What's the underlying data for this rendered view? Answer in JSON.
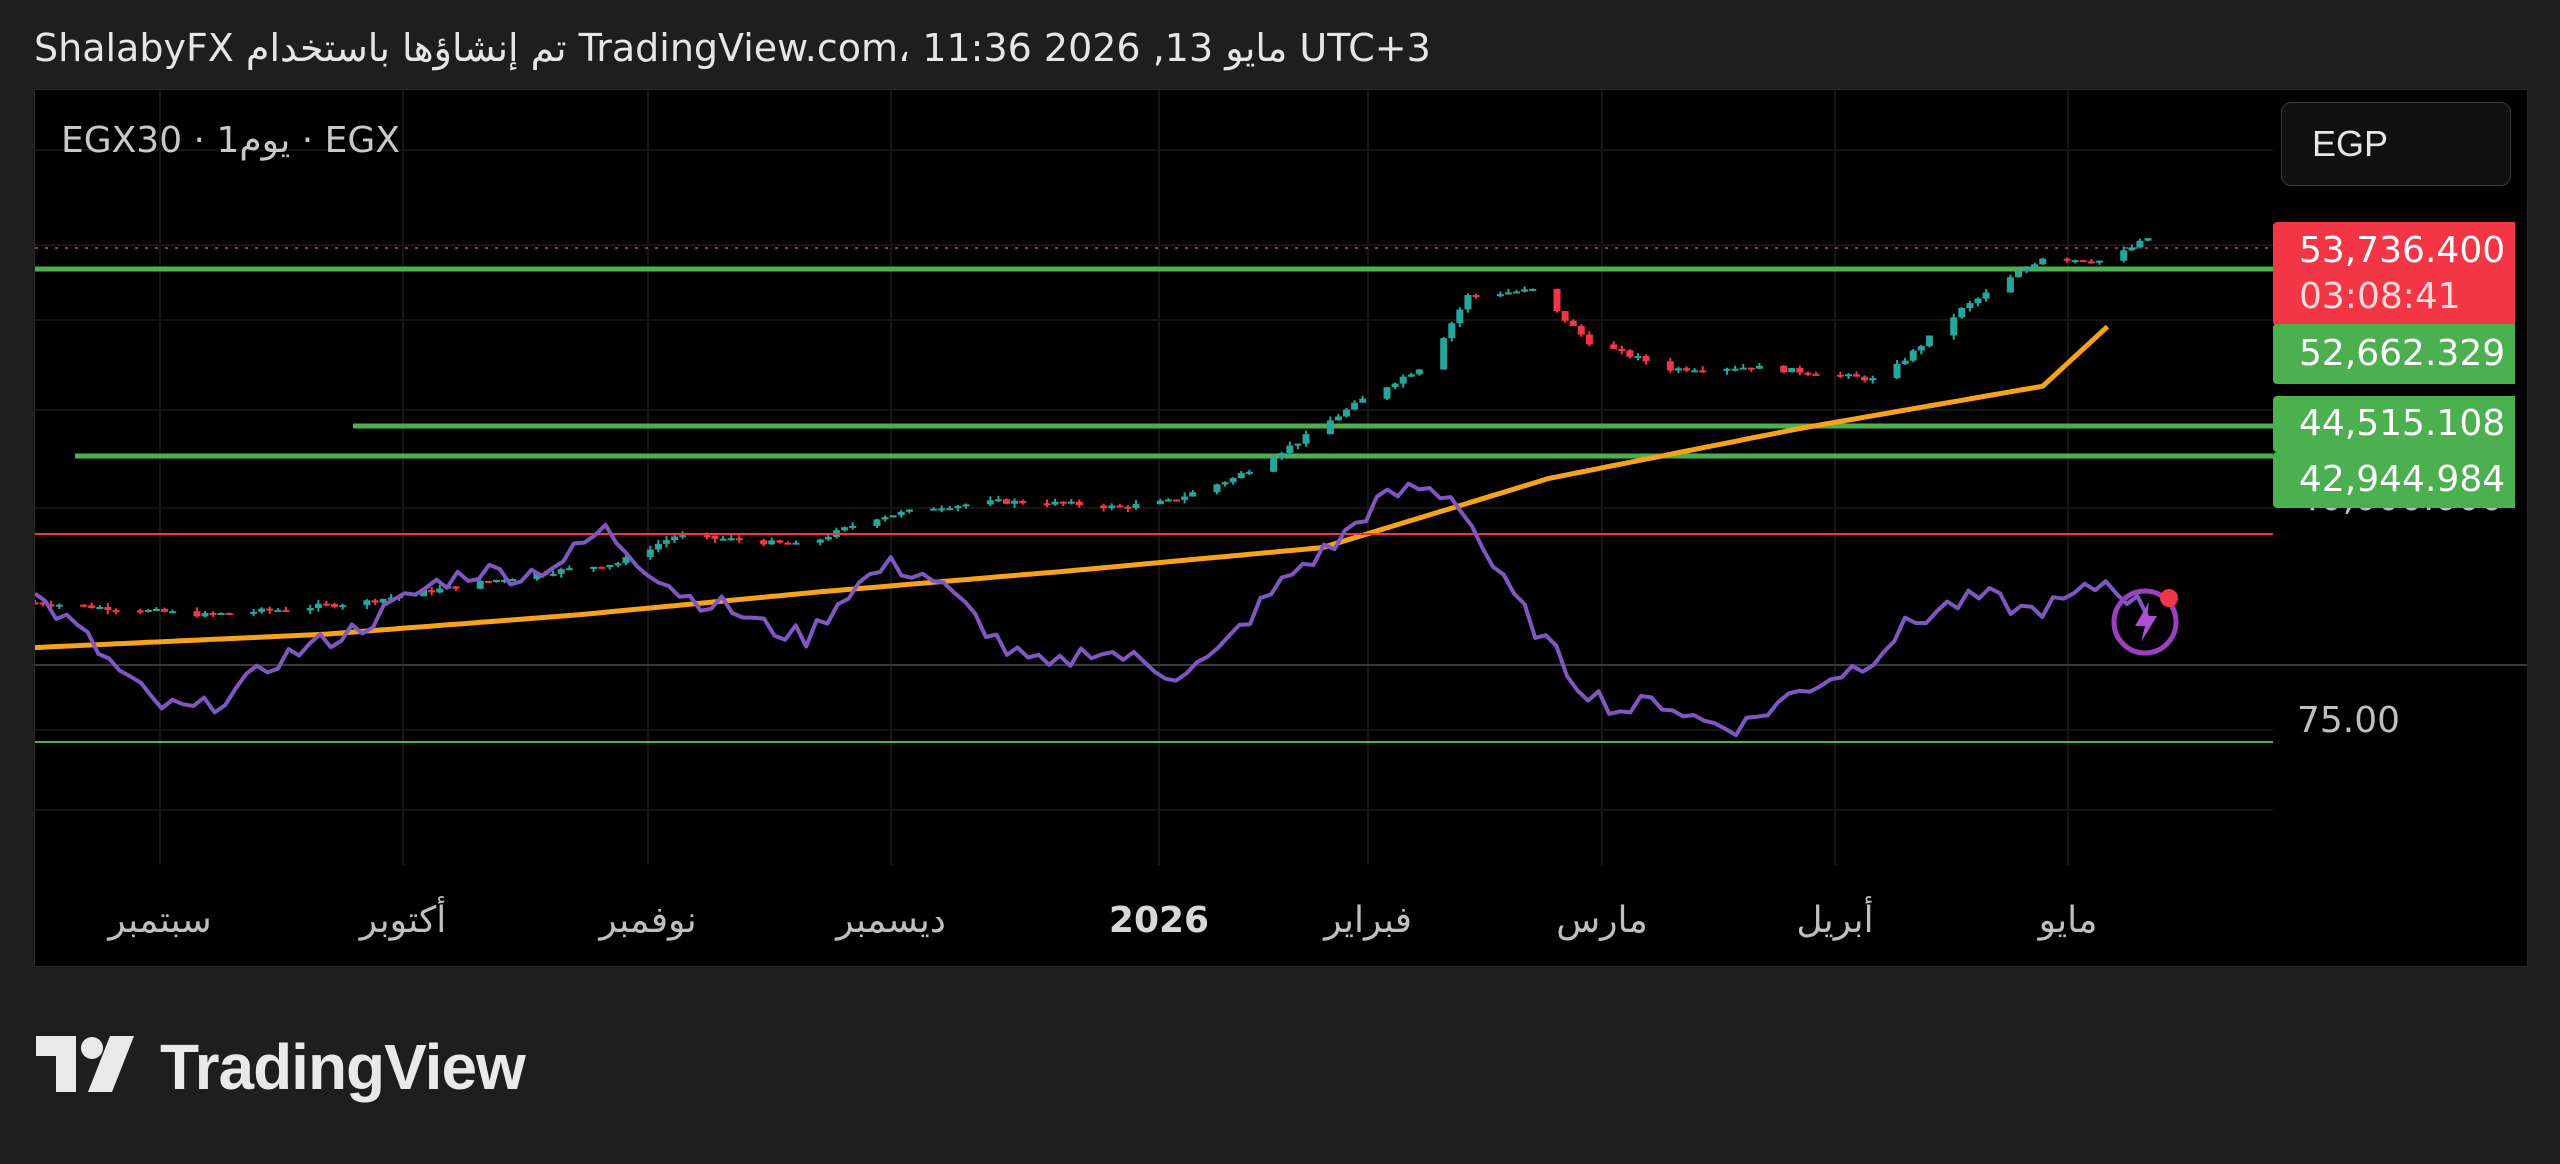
{
  "header": {
    "title": "ShalabyFX تم إنشاؤها باستخدام TradingView.com، 11:36 2026 ,13 مايو UTC+3"
  },
  "symbol": {
    "label": "EGX30 · 1يوم · EGX"
  },
  "currency": "EGP",
  "price_labels": {
    "last_price": "53,736.400",
    "countdown": "03:08:41",
    "sma_value": "52,662.329",
    "level_1": "44,515.108",
    "level_2": "42,944.984"
  },
  "axis": {
    "price_tick": "40,000.000",
    "rsi_tick": "75.00"
  },
  "time_axis": [
    "سبتمبر",
    "أكتوبر",
    "نوفمبر",
    "ديسمبر",
    "2026",
    "فبراير",
    "مارس",
    "أبريل",
    "مايو"
  ],
  "footer": {
    "logo_text": "TradingView"
  },
  "colors": {
    "up": "#26a69a",
    "down": "#f23645",
    "level": "#4caf50",
    "sma": "#f7a21b",
    "rsi": "#7e57c2",
    "last_price_bg": "#f23645"
  },
  "chart_data": {
    "type": "candlestick",
    "symbol": "EGX30",
    "interval": "1D",
    "currency": "EGP",
    "last_price": 53736.4,
    "price_levels": [
      {
        "price": 52662.329,
        "color": "#4caf50"
      },
      {
        "price": 44515.108,
        "color": "#4caf50"
      },
      {
        "price": 42944.984,
        "color": "#4caf50"
      }
    ],
    "moving_average_last": 52662.329,
    "close_series_approx": {
      "x": [
        "2025-08-25",
        "2025-09-05",
        "2025-09-15",
        "2025-09-25",
        "2025-10-05",
        "2025-10-15",
        "2025-10-25",
        "2025-11-05",
        "2025-11-12",
        "2025-11-20",
        "2025-11-28",
        "2025-12-06",
        "2025-12-14",
        "2025-12-22",
        "2025-12-30",
        "2026-01-06",
        "2026-01-12",
        "2026-01-20",
        "2026-01-28",
        "2026-02-05",
        "2026-02-13",
        "2026-02-18",
        "2026-02-26",
        "2026-03-05",
        "2026-03-15",
        "2026-03-25",
        "2026-04-02",
        "2026-04-10",
        "2026-04-20",
        "2026-04-30",
        "2026-05-08",
        "2026-05-13"
      ],
      "y": [
        36250,
        35900,
        35600,
        35900,
        36300,
        37000,
        37700,
        38300,
        39700,
        39500,
        39200,
        40600,
        41200,
        41500,
        41400,
        41200,
        41500,
        42700,
        44600,
        46800,
        48700,
        52200,
        52500,
        49800,
        48400,
        48500,
        48200,
        47800,
        51500,
        54200,
        54000,
        55200
      ]
    },
    "sma_series_approx": {
      "x": [
        "2025-08-25",
        "2025-09-30",
        "2025-10-31",
        "2025-11-30",
        "2025-12-31",
        "2026-01-31",
        "2026-02-28",
        "2026-03-31",
        "2026-04-30",
        "2026-05-08"
      ],
      "y": [
        33900,
        34600,
        35600,
        36800,
        37900,
        39100,
        42700,
        45300,
        47500,
        50600
      ]
    },
    "rsi": {
      "reference_levels": [
        70,
        30
      ],
      "visible_tick": 75,
      "values_approx": [
        58,
        52,
        44,
        37,
        36,
        40,
        46,
        49,
        52,
        57,
        61,
        63,
        62,
        65,
        71,
        64,
        58,
        56,
        52,
        50,
        59,
        64,
        62,
        55,
        47,
        44,
        48,
        46,
        43,
        46,
        55,
        63,
        68,
        76,
        79,
        77,
        62,
        51,
        41,
        36,
        38,
        34,
        33,
        38,
        42,
        45,
        52,
        56,
        58,
        55,
        57,
        61,
        55
      ]
    }
  }
}
